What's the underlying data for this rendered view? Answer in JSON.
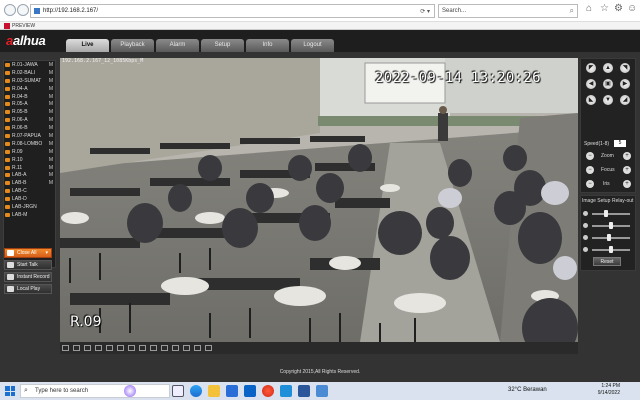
{
  "browser": {
    "address": "http://192.168.2.167/",
    "search_placeholder": "Search...",
    "tab_title": "PREVIEW"
  },
  "app": {
    "logo_main": "alhua",
    "logo_accent": "a",
    "tabs": [
      "Live",
      "Playback",
      "Alarm",
      "Setup",
      "Info",
      "Logout"
    ],
    "active_tab": "Live",
    "cameras": [
      {
        "name": "R.01-JAWA",
        "flag": "M"
      },
      {
        "name": "R.02-BALI",
        "flag": "M"
      },
      {
        "name": "R.03-SUMAT",
        "flag": "M"
      },
      {
        "name": "R.04-A",
        "flag": "M"
      },
      {
        "name": "R.04-B",
        "flag": "M"
      },
      {
        "name": "R.05-A",
        "flag": "M"
      },
      {
        "name": "R.05-B",
        "flag": "M"
      },
      {
        "name": "R.06-A",
        "flag": "M"
      },
      {
        "name": "R.06-B",
        "flag": "M"
      },
      {
        "name": "R.07-PAPUA",
        "flag": "M"
      },
      {
        "name": "R.08-LOMBO",
        "flag": "M"
      },
      {
        "name": "R.09",
        "flag": "M"
      },
      {
        "name": "R.10",
        "flag": "M"
      },
      {
        "name": "R.11",
        "flag": "M"
      },
      {
        "name": "LAB-A",
        "flag": "M"
      },
      {
        "name": "LAB-B",
        "flag": "M"
      },
      {
        "name": "LAB-C",
        "flag": ""
      },
      {
        "name": "LAB-D",
        "flag": ""
      },
      {
        "name": "LAB-JRGN",
        "flag": ""
      },
      {
        "name": "LAB-M",
        "flag": ""
      }
    ],
    "buttons": {
      "close_all": "Close All",
      "start_talk": "Start Talk",
      "instant_record": "Instant Record",
      "local_play": "Local Play"
    },
    "video": {
      "osd_top": "192.168.2.167_12_1085Kbps_M",
      "osd_time": "2022-09-14 13:20:26",
      "osd_name": "R.09"
    },
    "ptz": {
      "speed_label": "Speed(1-8)",
      "speed_value": "5",
      "zoom_label": "Zoom",
      "focus_label": "Focus",
      "iris_label": "Iris"
    },
    "image_setup": {
      "tab1": "Image Setup",
      "tab2": "Relay-out",
      "levels": [
        0.35,
        0.5,
        0.45,
        0.5
      ],
      "reset": "Reset"
    },
    "copyright": "Copyright 2015,All Rights Reserved."
  },
  "taskbar": {
    "search_placeholder": "Type here to search",
    "weather": "32°C  Berawan",
    "time": "1:24 PM",
    "date": "9/14/2022"
  },
  "colors": {
    "accent_orange": "#e8741e",
    "logo_red": "#e41f26"
  }
}
